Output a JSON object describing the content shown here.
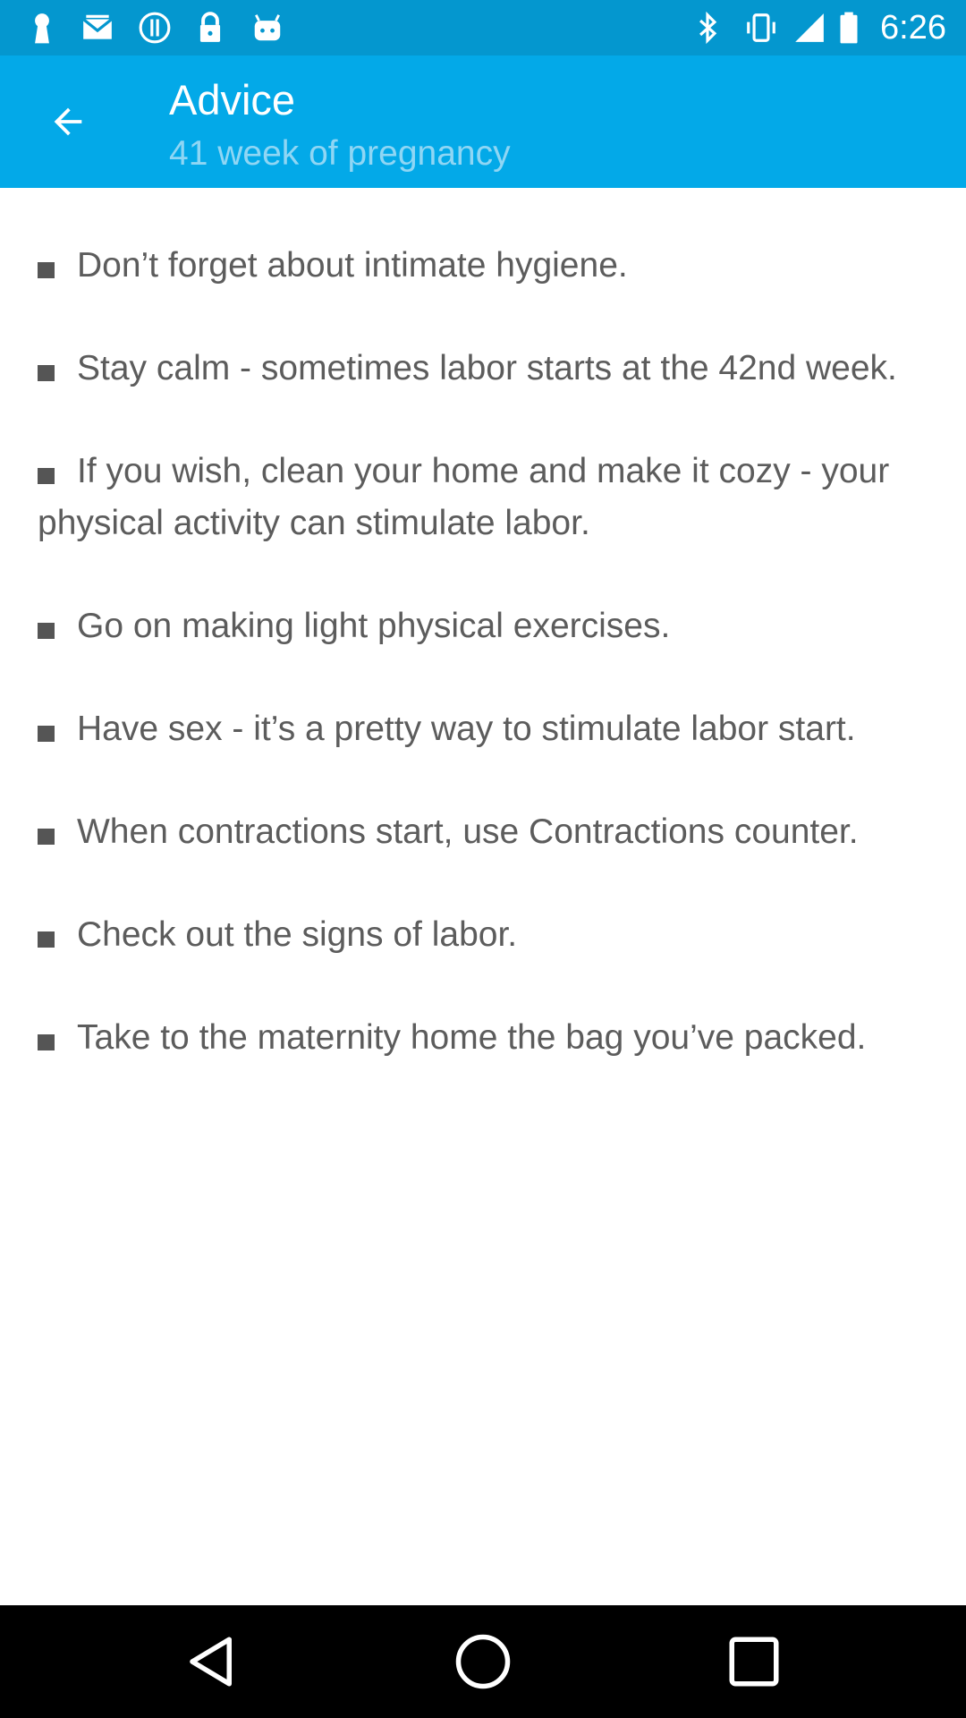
{
  "status_bar": {
    "time": "6:26",
    "icons_left": [
      "keyhole-icon",
      "email-icon",
      "info-icon",
      "lock-icon",
      "android-icon"
    ],
    "icons_right": [
      "bluetooth-icon",
      "vibrate-icon",
      "signal-icon",
      "battery-icon"
    ]
  },
  "app_bar": {
    "title": "Advice",
    "subtitle": "41 week of pregnancy",
    "back_icon": "arrow-back-icon",
    "color": "#03a9e8"
  },
  "advice": {
    "items": [
      "Don’t forget about intimate hygiene.",
      "Stay calm - sometimes labor starts at the 42nd week.",
      "If you wish, clean your home and make it cozy - your physical activity can stimulate labor.",
      "Go on making light physical exercises.",
      "Have sex - it’s a pretty way to stimulate labor start.",
      "When contractions start, use Contractions counter.",
      "Check out the signs of labor.",
      "Take to the maternity home the bag you’ve packed."
    ]
  },
  "nav_bar": {
    "buttons": [
      "back-triangle-icon",
      "home-circle-icon",
      "recents-square-icon"
    ]
  }
}
